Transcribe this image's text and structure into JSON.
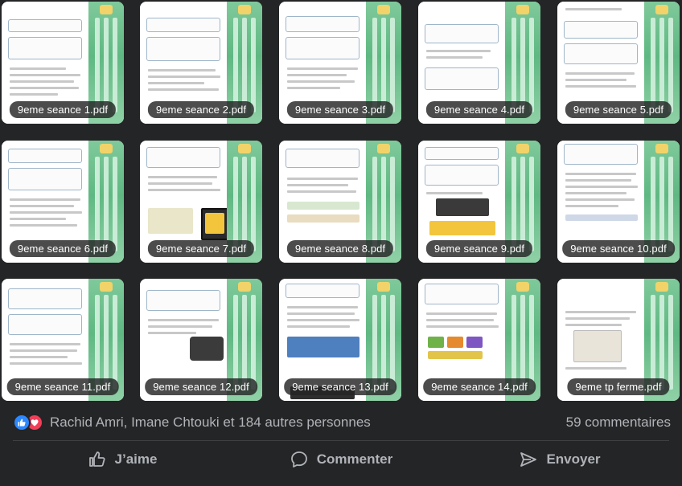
{
  "attachments": [
    {
      "label": "9eme seance 1.pdf"
    },
    {
      "label": "9eme seance 2.pdf"
    },
    {
      "label": "9eme seance 3.pdf"
    },
    {
      "label": "9eme seance 4.pdf"
    },
    {
      "label": "9eme seance 5.pdf"
    },
    {
      "label": "9eme seance 6.pdf"
    },
    {
      "label": "9eme seance 7.pdf"
    },
    {
      "label": "9eme seance 8.pdf"
    },
    {
      "label": "9eme seance 9.pdf"
    },
    {
      "label": "9eme seance 10.pdf"
    },
    {
      "label": "9eme seance 11.pdf"
    },
    {
      "label": "9eme seance 12.pdf"
    },
    {
      "label": "9eme seance 13.pdf"
    },
    {
      "label": "9eme seance 14.pdf"
    },
    {
      "label": "9eme tp ferme.pdf"
    }
  ],
  "reactions": {
    "icons": [
      "like-icon",
      "love-icon"
    ],
    "names": "Rachid Amri, Imane Chtouki et 184 autres personnes",
    "comments": "59 commentaires"
  },
  "actions": {
    "like": "J’aime",
    "comment": "Commenter",
    "send": "Envoyer"
  },
  "colors": {
    "background": "#242526",
    "text_secondary": "#b0b3b8",
    "like_blue": "#2d88ff",
    "love_red": "#f33e58",
    "sidebar_green": "#5fb882"
  }
}
